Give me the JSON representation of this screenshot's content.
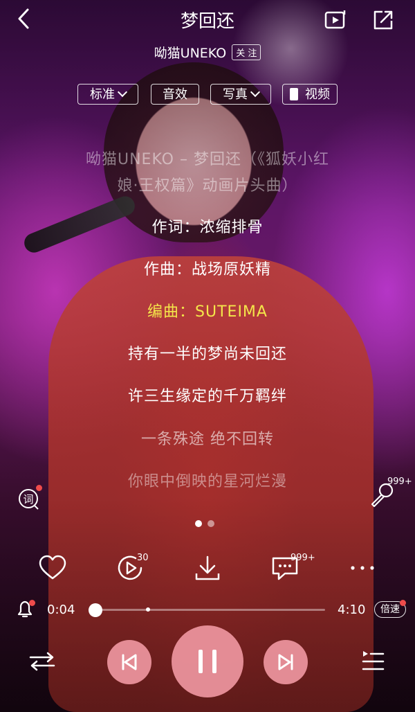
{
  "header": {
    "title": "梦回还",
    "artist": "呦猫UNEKO",
    "follow_label": "关 注"
  },
  "pills": [
    {
      "label": "标准",
      "dropdown": true
    },
    {
      "label": "音效",
      "dropdown": false
    },
    {
      "label": "写真",
      "dropdown": true
    },
    {
      "label": "视频",
      "dropdown": false
    }
  ],
  "lyrics": [
    {
      "text": "呦猫UNEKO – 梦回还（《狐妖小红",
      "state": "past"
    },
    {
      "text": "娘·王权篇》动画片头曲）",
      "state": "past"
    },
    {
      "text": "作词：浓缩排骨",
      "state": "normal"
    },
    {
      "text": "作曲：战场原妖精",
      "state": "normal"
    },
    {
      "text": "编曲：SUTEIMA",
      "state": "active"
    },
    {
      "text": "持有一半的梦尚未回还",
      "state": "normal"
    },
    {
      "text": "许三生缘定的千万羁绊",
      "state": "normal"
    },
    {
      "text": "一条殊途 绝不回转",
      "state": "upcoming"
    },
    {
      "text": "你眼中倒映的星河烂漫",
      "state": "faded"
    }
  ],
  "side": {
    "lyric_button_icon": "lyrics-icon",
    "mic_count": "999+"
  },
  "pager": {
    "pages": 2,
    "current": 1
  },
  "actions": {
    "like_icon": "heart-icon",
    "play_video_badge": "30",
    "download_icon": "download-icon",
    "comment_badge": "999+",
    "more_icon": "more-icon"
  },
  "playback": {
    "current_time": "0:04",
    "total_time": "4:10",
    "progress": 0.03,
    "marker": 0.25,
    "speed_label": "倍速"
  },
  "controls": {
    "mode_icon": "shuffle-icon",
    "prev_icon": "previous-icon",
    "pause_icon": "pause-icon",
    "next_icon": "next-icon",
    "playlist_icon": "playlist-icon"
  },
  "colors": {
    "active_lyric": "#f4e64a",
    "control_pink": "#ee96a0",
    "badge_red": "#f04b4b"
  }
}
